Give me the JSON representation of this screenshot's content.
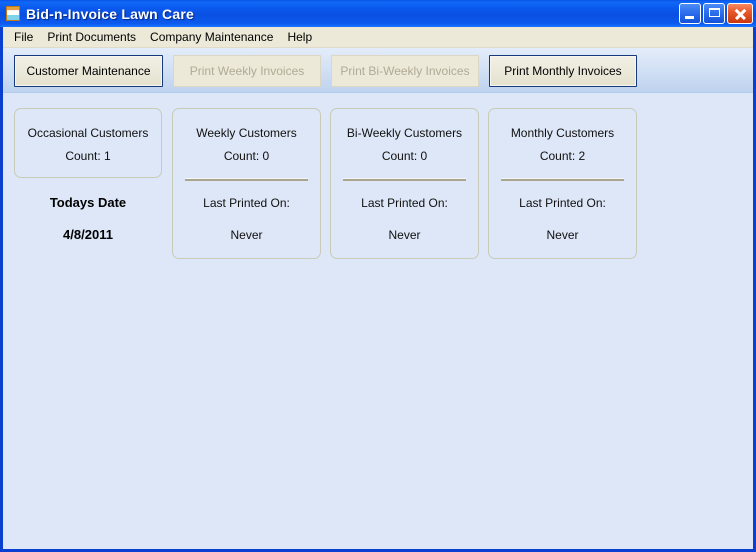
{
  "window": {
    "title": "Bid-n-Invoice Lawn Care",
    "icon": "clipboard-icon",
    "controls": {
      "minimize": "Minimize",
      "maximize": "Maximize",
      "close": "Close"
    }
  },
  "menubar": {
    "items": [
      {
        "label": "File"
      },
      {
        "label": "Print Documents"
      },
      {
        "label": "Company Maintenance"
      },
      {
        "label": "Help"
      }
    ]
  },
  "toolbar": {
    "buttons": [
      {
        "label": "Customer Maintenance",
        "enabled": true
      },
      {
        "label": "Print Weekly Invoices",
        "enabled": false
      },
      {
        "label": "Print Bi-Weekly Invoices",
        "enabled": false
      },
      {
        "label": "Print Monthly Invoices",
        "enabled": true
      }
    ]
  },
  "panels": [
    {
      "title": "Occasional Customers",
      "count_label": "Count: 1",
      "date_heading": "Todays Date",
      "date_value": "4/8/2011"
    },
    {
      "title": "Weekly Customers",
      "count_label": "Count: 0",
      "last_printed_label": "Last Printed On:",
      "last_printed_value": "Never"
    },
    {
      "title": "Bi-Weekly Customers",
      "count_label": "Count: 0",
      "last_printed_label": "Last Printed On:",
      "last_printed_value": "Never"
    },
    {
      "title": "Monthly Customers",
      "count_label": "Count: 2",
      "last_printed_label": "Last Printed On:",
      "last_printed_value": "Never"
    }
  ],
  "colors": {
    "titlebar_blue": "#0a4fe2",
    "client_background": "#dde7f7",
    "menubar": "#ece9d8",
    "button_face": "#ece9d8",
    "default_button_border": "#16387c",
    "close_button": "#ea5a2c"
  }
}
